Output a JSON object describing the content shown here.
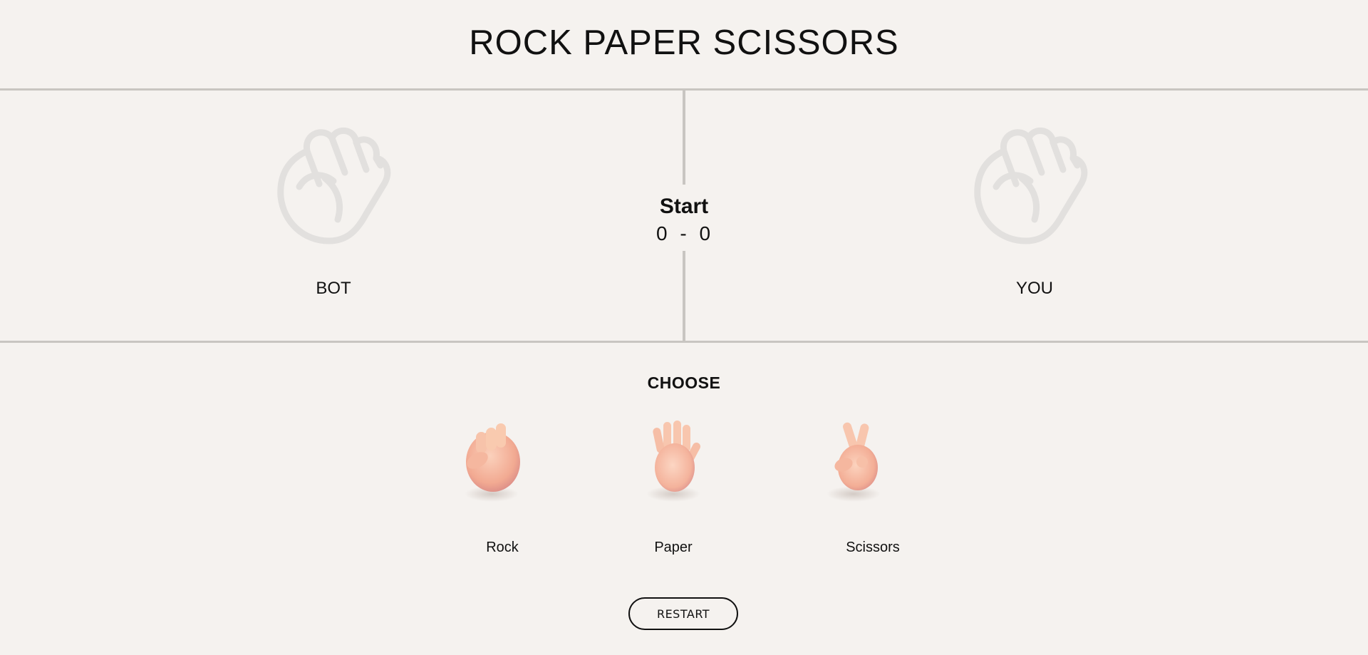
{
  "header": {
    "title": "ROCK PAPER SCISSORS"
  },
  "arena": {
    "bot": {
      "label": "BOT",
      "hand_icon": "fist-outline-icon"
    },
    "you": {
      "label": "YOU",
      "hand_icon": "fist-outline-icon"
    },
    "status": "Start",
    "score_bot": "0",
    "score_separator": "-",
    "score_you": "0"
  },
  "choices": {
    "heading": "CHOOSE",
    "items": [
      {
        "label": "Rock",
        "icon": "raised-fist-emoji-icon"
      },
      {
        "label": "Paper",
        "icon": "raised-hand-emoji-icon"
      },
      {
        "label": "Scissors",
        "icon": "victory-hand-emoji-icon"
      }
    ]
  },
  "controls": {
    "restart_label": "RESTART"
  },
  "colors": {
    "background": "#f5f2ef",
    "divider": "#c8c5c1",
    "outline_hand": "#e2e0de",
    "skin": "#f6b9a0"
  }
}
